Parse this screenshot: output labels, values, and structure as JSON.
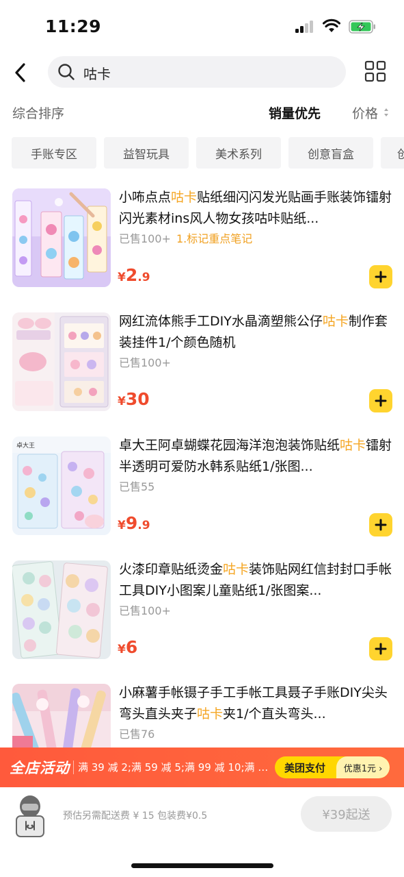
{
  "status_bar": {
    "time": "11:29",
    "icons": [
      "signal-icon",
      "wifi-icon",
      "battery-charging-icon"
    ]
  },
  "header": {
    "back_icon": "chevron-left-icon",
    "search_icon": "search-icon",
    "search_value": "咕卡",
    "grid_icon": "grid-view-icon"
  },
  "sort": {
    "default": "综合排序",
    "sales": "销量优先",
    "price": "价格"
  },
  "categories": [
    "手账专区",
    "益智玩具",
    "美术系列",
    "创意盲盒",
    "创意文具"
  ],
  "products": [
    {
      "title_parts": [
        "小咘点点",
        "咕卡",
        "贴纸细闪闪发光贴画手账装饰镭射闪光素材ins风人物女孩咕咔贴纸..."
      ],
      "sold": "已售100+",
      "tag": "1.标记重点笔记",
      "price_currency": "¥",
      "price_int": "2",
      "price_dec": ".9"
    },
    {
      "title_parts": [
        "网红流体熊手工DIY水晶滴塑熊公仔",
        "咕卡",
        "制作套装挂件1/个颜色随机"
      ],
      "sold": "已售100+",
      "tag": "",
      "price_currency": "¥",
      "price_int": "30",
      "price_dec": ""
    },
    {
      "title_parts": [
        "卓大王阿卓蝴蝶花园海洋泡泡装饰贴纸",
        "咕卡",
        "镭射半透明可爱防水韩系贴纸1/张图..."
      ],
      "sold": "已售55",
      "tag": "",
      "price_currency": "¥",
      "price_int": "9",
      "price_dec": ".9"
    },
    {
      "title_parts": [
        "火漆印章贴纸烫金",
        "咕卡",
        "装饰贴网红信封封口手帐工具DIY小图案儿童贴纸1/张图案..."
      ],
      "sold": "已售100+",
      "tag": "",
      "price_currency": "¥",
      "price_int": "6",
      "price_dec": ""
    },
    {
      "title_parts": [
        "小麻薯手帐镊子手工手帐工具聂子手账DIY尖头弯头直头夹子",
        "咕卡",
        "夹1/个直头弯头..."
      ],
      "sold": "已售76",
      "tag": "",
      "price_currency": "",
      "price_int": "",
      "price_dec": ""
    }
  ],
  "promo": {
    "title": "全店活动",
    "text": "满 39 减 2;满 59 减 5;满 99 减 10;满 1...",
    "pay_label": "美团支付",
    "coupon": "优惠1元 ›"
  },
  "cart": {
    "delivery_text": "预估另需配送费 ¥ 15  包装费¥0.5",
    "min_order": "¥39起送"
  },
  "colors": {
    "highlight": "#f5a623",
    "price": "#ef4b2d",
    "add_button": "#ffd42f",
    "promo_bg": "#ff5a3c"
  }
}
